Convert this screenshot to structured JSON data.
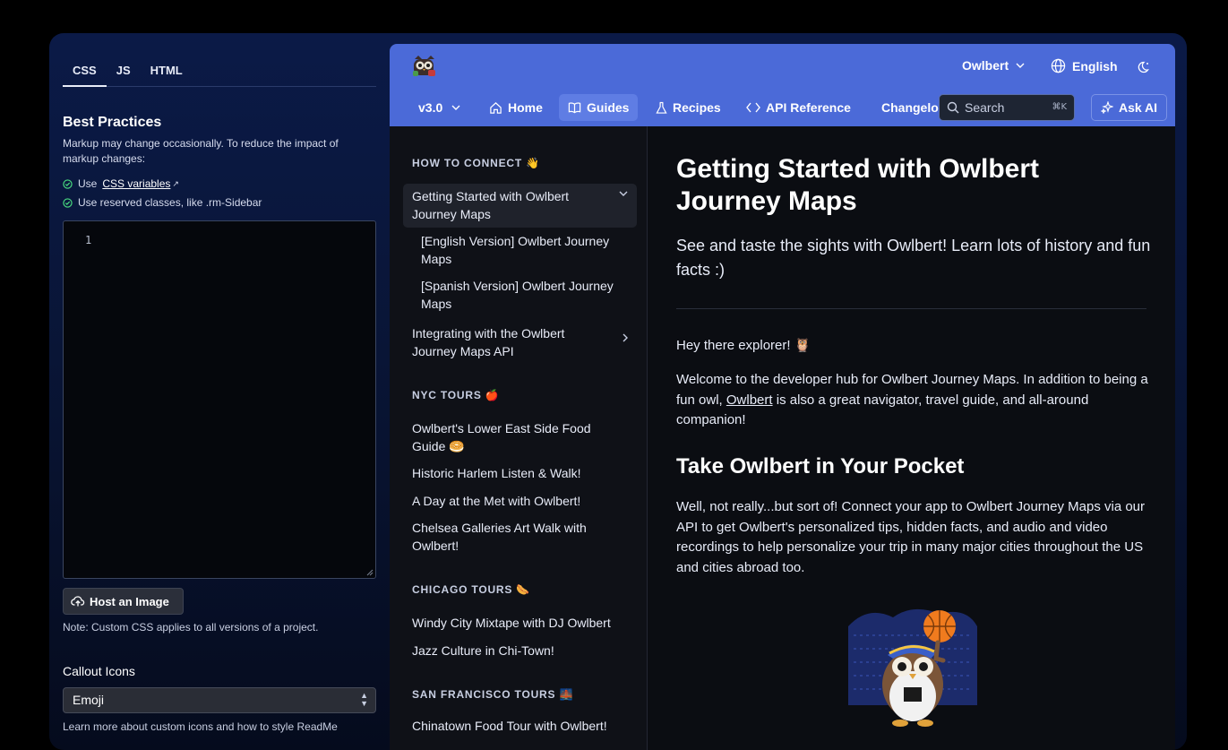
{
  "editor": {
    "tabs": [
      "CSS",
      "JS",
      "HTML"
    ],
    "best_practices_title": "Best Practices",
    "best_practices_desc": "Markup may change occasionally. To reduce the impact of markup changes:",
    "tip1_prefix": "Use",
    "tip1_link": "CSS variables",
    "tip2": "Use reserved classes, like .rm-Sidebar",
    "line_number": "1",
    "host_button": "Host an Image",
    "note": "Note: Custom CSS applies to all versions of a project.",
    "callout_label": "Callout Icons",
    "callout_value": "Emoji",
    "learn_more": "Learn more about custom icons and how to style ReadMe"
  },
  "header": {
    "project": "Owlbert",
    "language": "English",
    "version": "v3.0",
    "nav": [
      "Home",
      "Guides",
      "Recipes",
      "API Reference",
      "Changelog"
    ],
    "active_nav": "Guides",
    "search_placeholder": "Search",
    "search_shortcut": "⌘K",
    "ask_ai": "Ask AI"
  },
  "sidebar": {
    "sections": [
      {
        "title": "HOW TO CONNECT 👋"
      },
      {
        "title": "NYC TOURS 🍎"
      },
      {
        "title": "CHICAGO TOURS 🌭"
      },
      {
        "title": "SAN FRANCISCO TOURS 🌉"
      }
    ],
    "items": [
      "Getting Started with Owlbert Journey Maps",
      "[English Version] Owlbert Journey Maps",
      "[Spanish Version] Owlbert Journey Maps",
      "Integrating with the Owlbert Journey Maps API",
      "Owlbert's Lower East Side Food Guide 🥯",
      "Historic Harlem Listen & Walk!",
      "A Day at the Met with Owlbert!",
      "Chelsea Galleries Art Walk with Owlbert!",
      "Windy City Mixtape with DJ Owlbert",
      "Jazz Culture in Chi-Town!",
      "Chinatown Food Tour with Owlbert!"
    ]
  },
  "content": {
    "title": "Getting Started with Owlbert Journey Maps",
    "subtitle": "See and taste the sights with Owlbert! Learn lots of history and fun facts :)",
    "greeting": "Hey there explorer! 🦉",
    "welcome_a": "Welcome to the developer hub for Owlbert Journey Maps. In addition to being a fun owl, ",
    "welcome_link": "Owlbert",
    "welcome_b": " is also a great navigator, travel guide, and all-around companion!",
    "h2": "Take Owlbert in Your Pocket",
    "para2": "Well, not really...but sort of! Connect your app to Owlbert Journey Maps via our API to get Owlbert's personalized tips, hidden facts, and audio and video recordings to help personalize your trip in many major cities throughout the US and cities abroad too."
  }
}
